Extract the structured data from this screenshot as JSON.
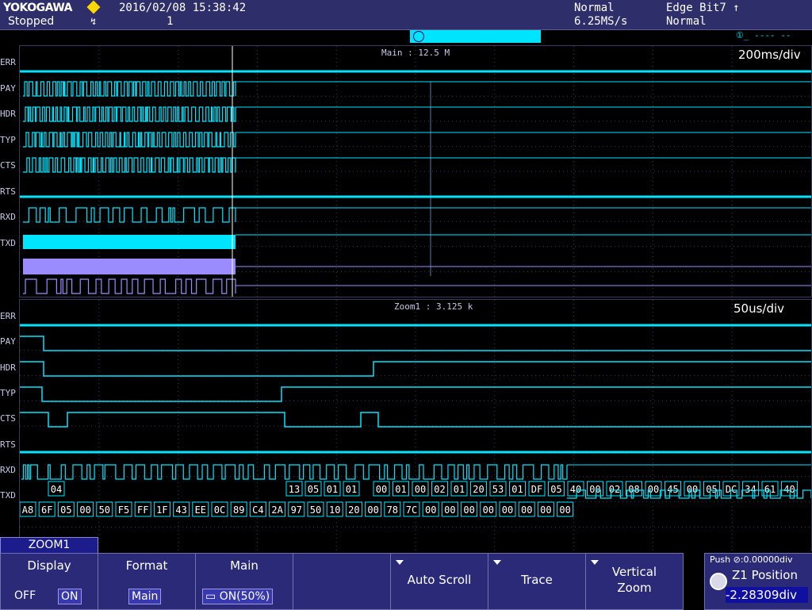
{
  "header": {
    "brand": "YOKOGAWA",
    "status": "Stopped",
    "trigger_icon": "↯",
    "datetime": "2016/02/08 15:38:42",
    "acq_count": "1",
    "acq_mode": "Normal",
    "sample_rate": "6.25MS/s",
    "trigger_type": "Edge Bit7 ↑",
    "trigger_mode": "Normal",
    "top_marker": "①_ ---- --"
  },
  "channels": [
    "ERR",
    "PAY",
    "HDR",
    "TYP",
    "CTS",
    "RTS",
    "RXD",
    "TXD"
  ],
  "main": {
    "label": "Main : 12.5 M",
    "timebase": "200ms/div"
  },
  "zoom": {
    "label": "Zoom1 : 3.125 k",
    "timebase": "50us/div",
    "rxd_labels": [
      "04",
      "13",
      "05",
      "01",
      "01",
      "00",
      "01",
      "00",
      "02",
      "01",
      "20",
      "53",
      "01",
      "DF",
      "05",
      "40",
      "00",
      "02",
      "08",
      "00",
      "45",
      "00",
      "05",
      "DC",
      "34",
      "61",
      "40"
    ],
    "txd_labels": [
      "A8",
      "6F",
      "05",
      "00",
      "50",
      "F5",
      "FF",
      "1F",
      "43",
      "EE",
      "0C",
      "89",
      "C4",
      "2A",
      "97",
      "50",
      "10",
      "20",
      "00",
      "78",
      "7C",
      "00",
      "00",
      "00",
      "00",
      "00",
      "00",
      "00",
      "00"
    ]
  },
  "menu": {
    "tab": "ZOOM1",
    "display": {
      "title": "Display",
      "off": "OFF",
      "on": "ON"
    },
    "format": {
      "title": "Format",
      "value": "Main"
    },
    "main": {
      "title": "Main",
      "value": "ON(50%)"
    },
    "auto_scroll": "Auto Scroll",
    "trace": "Trace",
    "vertical_zoom_1": "Vertical",
    "vertical_zoom_2": "Zoom",
    "push_hint": "Push ⊘:0.00000div",
    "position_title": "Z1 Position",
    "position_value": "-2.28309div"
  },
  "colors": {
    "trace": "#00e5ff",
    "bus": "#9a8cff",
    "grid": "#3a3a5a"
  }
}
